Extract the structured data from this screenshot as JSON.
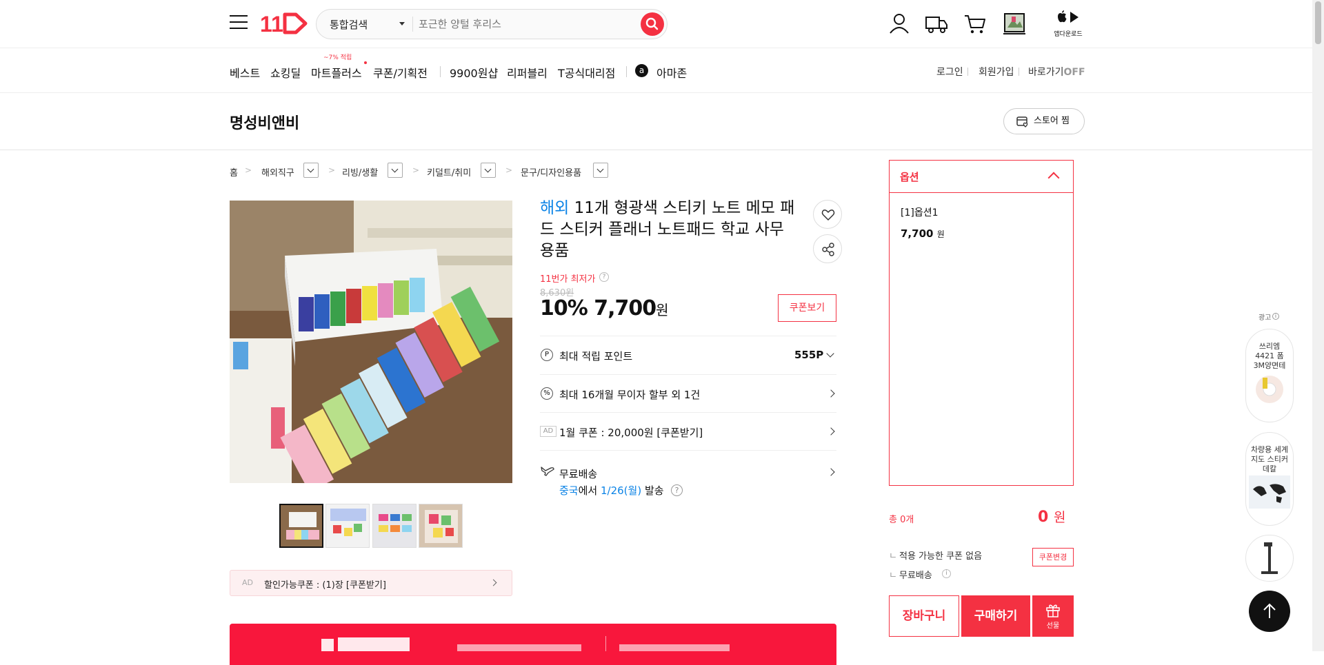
{
  "header": {
    "search_category": "통합검색",
    "search_placeholder": "포근한 양털 후리스",
    "app_download": "앱다운로드"
  },
  "nav": {
    "items": [
      "베스트",
      "쇼킹딜",
      "마트플러스",
      "쿠폰/기획전",
      "9900원샵",
      "리퍼블리",
      "T공식대리점",
      "아마존"
    ],
    "mart_badge": "~7% 적립",
    "amazon_letter": "a",
    "login": "로그인",
    "signup": "회원가입",
    "shortcut": "바로가기",
    "shortcut_state": "OFF"
  },
  "store": {
    "name": "명성비앤비",
    "fav_label": "스토어 찜"
  },
  "breadcrumb": [
    "홈",
    "해외직구",
    "리빙/생활",
    "키덜트/취미",
    "문구/디자인용품"
  ],
  "product": {
    "overseas_tag": "해외",
    "title": "11개 형광색 스티키 노트 메모 패드 스티커 플래너 노트패드 학교 사무 용품",
    "lowest_label": "11번가 최저가",
    "original_price": "8,630원",
    "discount": "10%",
    "price": "7,700",
    "won": "원",
    "coupon_btn": "쿠폰보기",
    "points_label": "최대 적립 포인트",
    "points_value": "555P",
    "installment": "최대 16개월 무이자 할부 외 1건",
    "ad_tag": "AD",
    "jan_coupon": "1월 쿠폰 : 20,000원 [쿠폰받기]",
    "shipping": "무료배송",
    "ship_from": "중국",
    "ship_mid": "에서",
    "ship_date": "1/26(월)",
    "ship_end": "발송",
    "discount_coupon": "할인가능쿠폰 : (1)장 [쿠폰받기]"
  },
  "options": {
    "title": "옵션",
    "item_name": "[1]옵션1",
    "item_price": "7,700",
    "item_won": "원",
    "total_label": "총 0개",
    "total_price": "0",
    "total_won": "원",
    "coupon_none": "적용 가능한 쿠폰 없음",
    "coupon_change": "쿠폰변경",
    "free_ship": "무료배송",
    "cart": "장바구니",
    "buy": "구매하기",
    "gift": "선물"
  },
  "side_ads": {
    "label": "광고",
    "ad1": "쓰리엠 4421 폼 3M양면테",
    "ad2": "차량용 세계지도 스티커 데칼"
  },
  "colors": {
    "accent": "#f43142",
    "blue": "#0b83e6"
  }
}
